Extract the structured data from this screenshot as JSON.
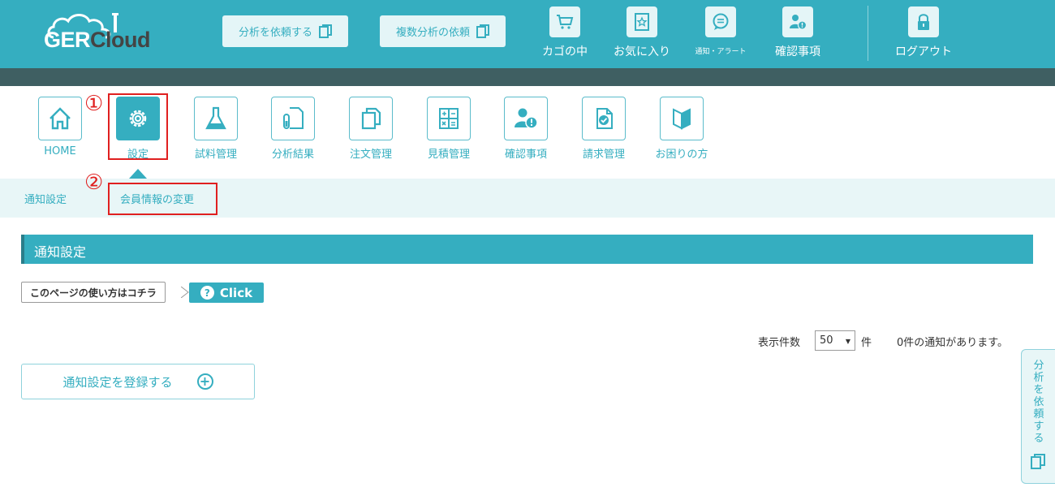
{
  "brand": {
    "logo_main": "GER",
    "logo_sub": "Cloud"
  },
  "header": {
    "request_analysis": "分析を依頼する",
    "request_multi": "複数分析の依頼",
    "icons": [
      {
        "label": "カゴの中",
        "icon": "cart-icon"
      },
      {
        "label": "お気に入り",
        "icon": "favorite-icon"
      },
      {
        "label": "通知・アラート",
        "icon": "chat-icon"
      },
      {
        "label": "確認事項",
        "icon": "user-alert-icon"
      },
      {
        "label": "ログアウト",
        "icon": "lock-icon"
      }
    ]
  },
  "nav": {
    "items": [
      {
        "label": "HOME",
        "icon": "home-icon"
      },
      {
        "label": "設定",
        "icon": "gear-icon",
        "active": true
      },
      {
        "label": "試料管理",
        "icon": "flask-icon"
      },
      {
        "label": "分析結果",
        "icon": "test-tube-doc-icon"
      },
      {
        "label": "注文管理",
        "icon": "copy-icon"
      },
      {
        "label": "見積管理",
        "icon": "calculator-icon"
      },
      {
        "label": "確認事項",
        "icon": "user-alert-icon"
      },
      {
        "label": "請求管理",
        "icon": "check-doc-icon"
      },
      {
        "label": "お困りの方",
        "icon": "beginner-icon"
      }
    ]
  },
  "subnav": {
    "items": [
      "通知設定",
      "会員情報の変更"
    ]
  },
  "annotations": {
    "one": "①",
    "two": "②",
    "color": "#e02020"
  },
  "content": {
    "section_title": "通知設定",
    "howto_label": "このページの使い方はコチラ",
    "click_label": "Click",
    "click_icon": "?",
    "display_count_label": "表示件数",
    "page_size": "50",
    "unit": "件",
    "notice_count": "0件の通知があります。",
    "register_button": "通知設定を登録する",
    "register_icon": "+"
  },
  "side_tab": {
    "label": "分析を依頼する"
  },
  "colors": {
    "primary": "#35aec0",
    "dark_strip": "#3f5f62",
    "light_bg": "#e8f6f7",
    "annotation": "#e02020"
  }
}
